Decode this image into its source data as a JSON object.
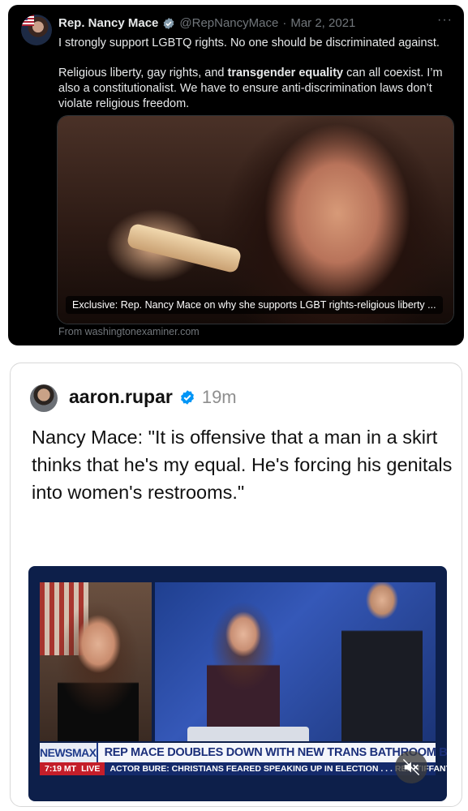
{
  "tweet": {
    "author_name": "Rep. Nancy Mace",
    "handle": "@RepNancyMace",
    "separator": "·",
    "date": "Mar 2, 2021",
    "more": "···",
    "text_line1": "I strongly support LGBTQ rights. No one should be discriminated against.",
    "text_p2_before": "Religious liberty, gay rights, and ",
    "text_p2_bold": "transgender equality",
    "text_p2_after": " can all coexist. I’m also a constitutionalist. We have to ensure anti-discrimination laws don’t violate religious freedom.",
    "link_card": {
      "overlay_title": "Exclusive: Rep. Nancy Mace on why she supports LGBT rights-religious liberty ...",
      "source": "From washingtonexaminer.com"
    },
    "icons": {
      "verified": "verified-badge-icon",
      "more": "more-options-icon"
    },
    "colors": {
      "background": "#000000",
      "verified": "#829aab"
    }
  },
  "post": {
    "author_name": "aaron.rupar",
    "time": "19m",
    "text": "Nancy Mace: \"It is offensive that a man in a skirt thinks that he's my equal. He's forcing his genitals into women's restrooms.\"",
    "video": {
      "network": "NEWSMAX",
      "headline": "REP MACE DOUBLES DOWN WITH NEW TRANS BATHROOM B",
      "clock": "7:19 MT",
      "live_label": "LIVE",
      "ticker": "ACTOR BURE: CHRISTIANS FEARED SPEAKING UP IN ELECTION . . .     REP. TIFFANY",
      "mute_icon": "muted-speaker-icon"
    },
    "icons": {
      "verified": "verified-badge-icon"
    },
    "colors": {
      "verified": "#0095f6",
      "network_bar": "#142a6b",
      "live_red": "#c41e2a"
    }
  }
}
